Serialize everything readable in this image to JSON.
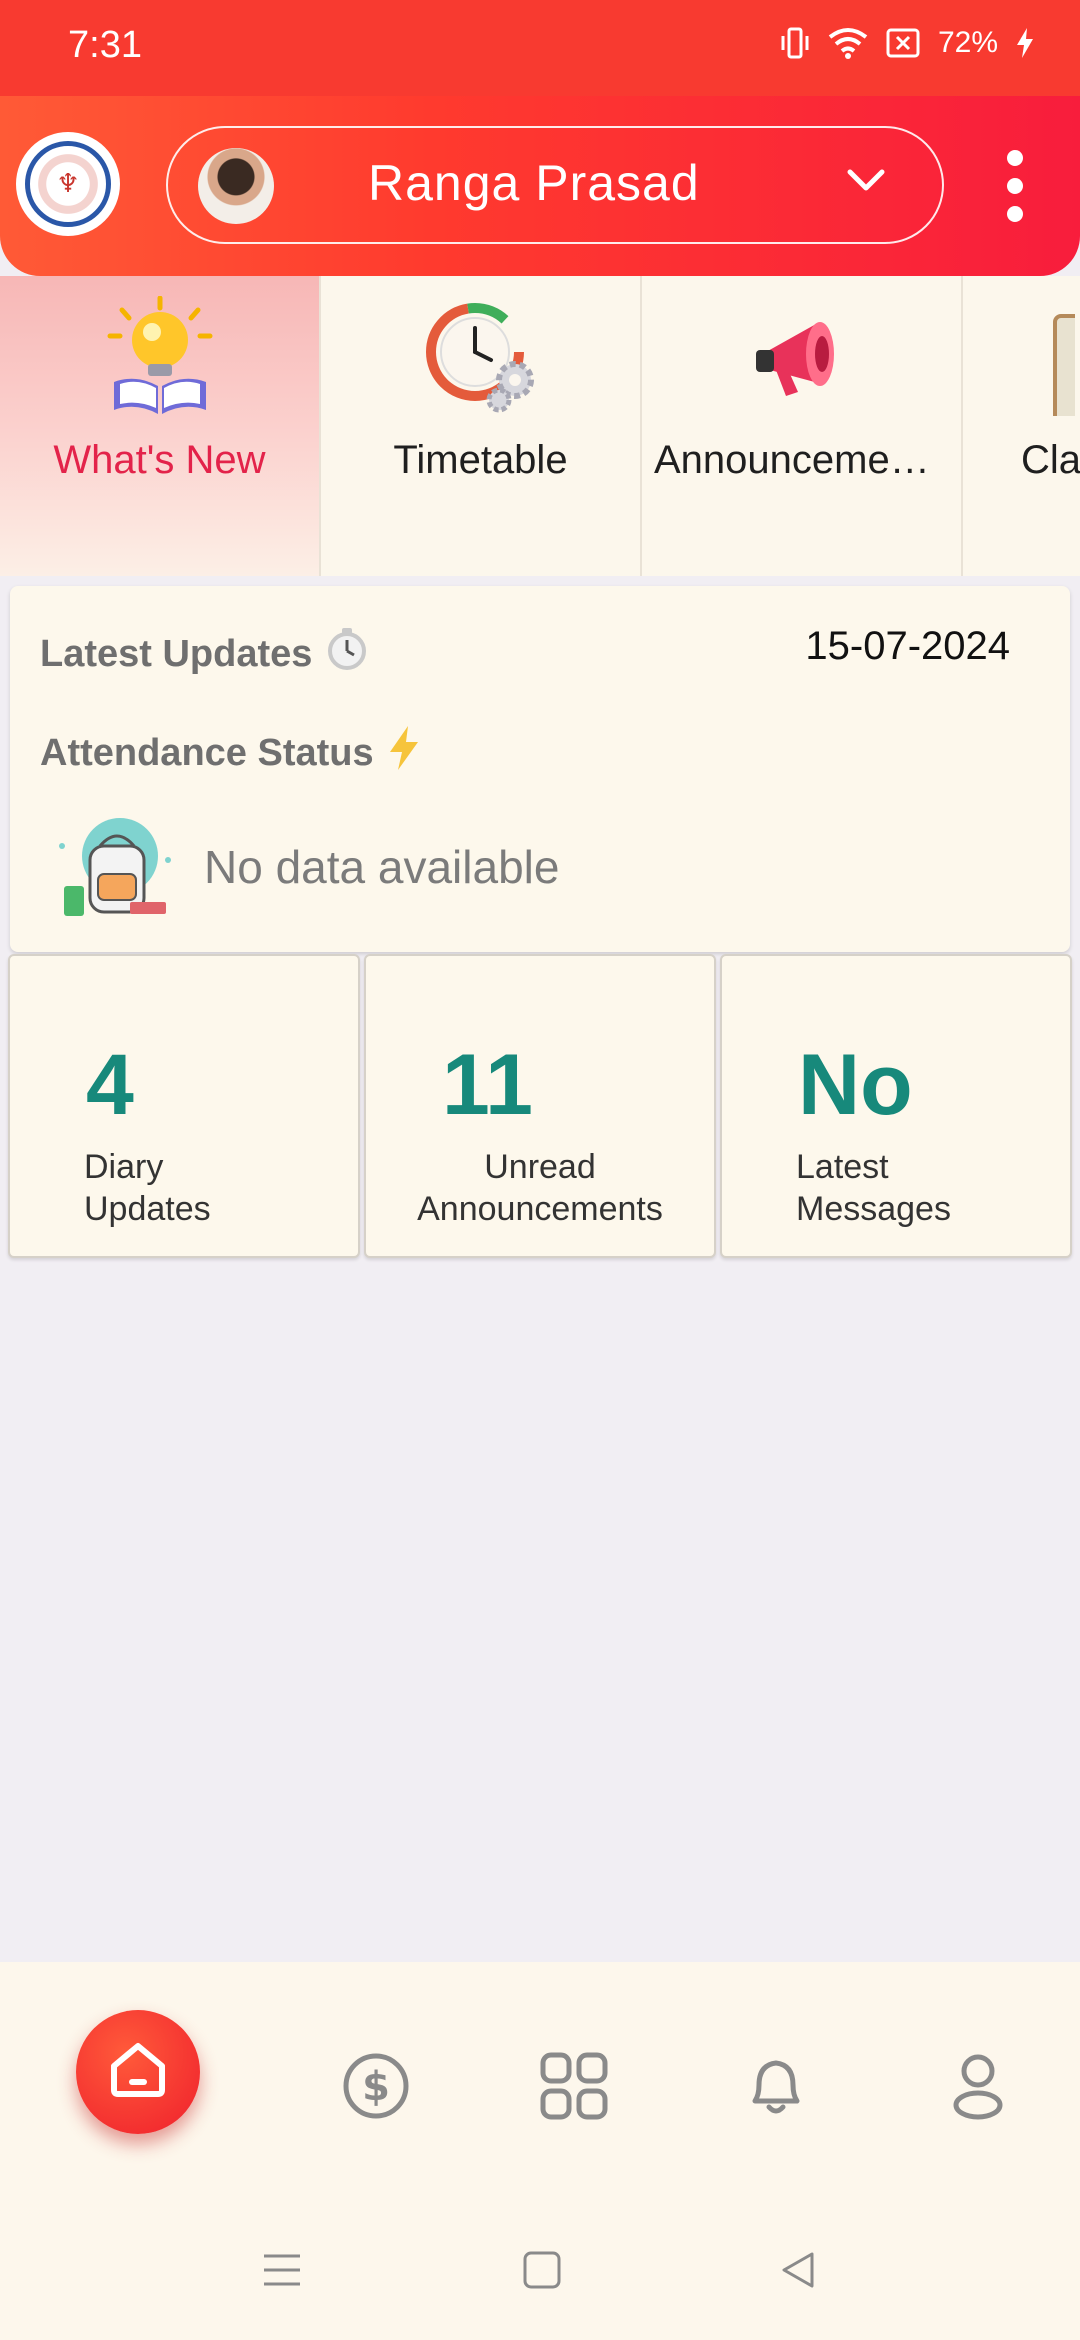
{
  "status_bar": {
    "time": "7:31",
    "battery": "72%",
    "icons": [
      "vibrate-icon",
      "wifi-icon",
      "no-sim-icon",
      "charging-icon"
    ]
  },
  "header": {
    "user_name": "Ranga Prasad",
    "icons": [
      "school-logo",
      "avatar",
      "chevron-down-icon",
      "more-vert-icon"
    ]
  },
  "tabs": [
    {
      "label": "What's New",
      "icon": "bulb-book-icon",
      "active": true
    },
    {
      "label": "Timetable",
      "icon": "clock-gear-icon",
      "active": false
    },
    {
      "label": "Announcemen…",
      "icon": "megaphone-icon",
      "active": false
    },
    {
      "label": "Cla",
      "icon": "book-icon",
      "active": false
    }
  ],
  "updates": {
    "latest_title": "Latest Updates",
    "date": "15-07-2024",
    "attendance_title": "Attendance Status",
    "empty_text": "No data available"
  },
  "stats": [
    {
      "value": "4",
      "label_line1": "Diary",
      "label_line2": "Updates"
    },
    {
      "value": "11",
      "label_line1": "Unread",
      "label_line2": "Announcements"
    },
    {
      "value": "No",
      "label_line1": "Latest",
      "label_line2": "Messages"
    }
  ],
  "bottom_nav": {
    "items": [
      "home-icon",
      "dollar-icon",
      "grid-icon",
      "bell-icon",
      "profile-icon"
    ]
  },
  "system_nav": [
    "menu-icon",
    "home-square-icon",
    "back-icon"
  ],
  "colors": {
    "header_red": "#f83a30",
    "accent_teal": "#17897b",
    "active_tab_text": "#e3234a",
    "card_bg": "#fdf8ec"
  }
}
